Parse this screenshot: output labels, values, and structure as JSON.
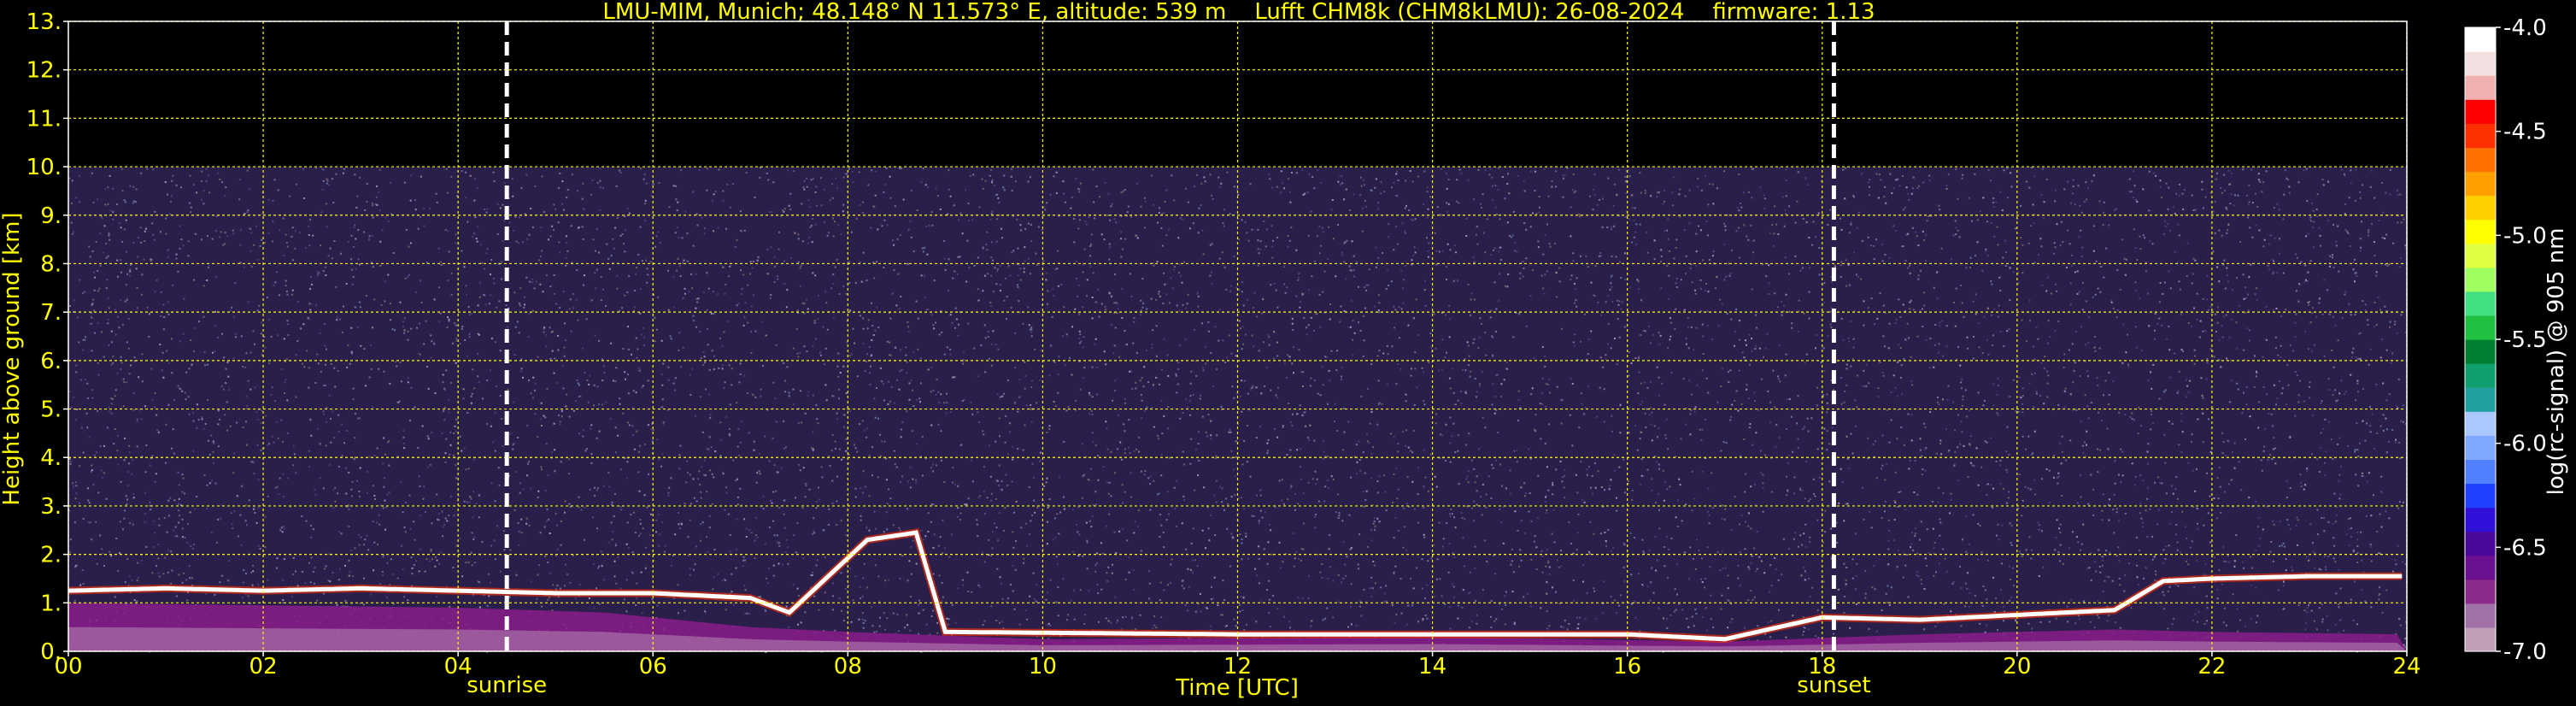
{
  "chart_data": {
    "type": "heatmap",
    "title": "LMU-MIM, Munich; 48.148° N 11.573° E, altitude: 539 m    Lufft CHM8k (CHM8kLMU): 26-08-2024    firmware: 1.13",
    "xlabel": "Time [UTC]",
    "ylabel": "Height above ground [km]",
    "x_ticks": [
      "00",
      "02",
      "04",
      "06",
      "08",
      "10",
      "12",
      "14",
      "16",
      "18",
      "20",
      "22",
      "24"
    ],
    "x_tick_values": [
      0,
      2,
      4,
      6,
      8,
      10,
      12,
      14,
      16,
      18,
      20,
      22,
      24
    ],
    "y_ticks": [
      "0.",
      "1.",
      "2.",
      "3.",
      "4.",
      "5.",
      "6.",
      "7.",
      "8.",
      "9.",
      "10.",
      "11.",
      "12.",
      "13."
    ],
    "y_tick_values": [
      0,
      1,
      2,
      3,
      4,
      5,
      6,
      7,
      8,
      9,
      10,
      11,
      12,
      13
    ],
    "xlim": [
      0,
      24
    ],
    "ylim": [
      0,
      13
    ],
    "grid": true,
    "grid_color": "#ffff00",
    "text_color": "#ffff00",
    "background": "#000000",
    "data_top_km": 10.0,
    "markers": [
      {
        "label": "sunrise",
        "time": 4.5
      },
      {
        "label": "sunset",
        "time": 18.12
      }
    ],
    "colorbar": {
      "label": "log(rc-signal) @ 905 nm",
      "range": [
        -7.0,
        -4.0
      ],
      "tick_labels": [
        "-4.0",
        "-4.5",
        "-5.0",
        "-5.5",
        "-6.0",
        "-6.5",
        "-7.0"
      ],
      "tick_values": [
        -4.0,
        -4.5,
        -5.0,
        -5.5,
        -6.0,
        -6.5,
        -7.0
      ],
      "colors": [
        "#c0a0b8",
        "#a070a8",
        "#8c2a8c",
        "#6a1090",
        "#4a0898",
        "#3010d8",
        "#2040ff",
        "#5080ff",
        "#80a8ff",
        "#a8c8ff",
        "#20a0a0",
        "#10a070",
        "#008030",
        "#20c040",
        "#40e080",
        "#a0ff60",
        "#e0ff40",
        "#ffff00",
        "#ffd000",
        "#ffa000",
        "#ff7000",
        "#ff3000",
        "#ff0000",
        "#f0b0b0",
        "#f0e0e0",
        "#ffffff"
      ]
    },
    "cloud_base_km": [
      [
        0.0,
        1.25
      ],
      [
        1.0,
        1.3
      ],
      [
        2.0,
        1.25
      ],
      [
        3.0,
        1.3
      ],
      [
        4.0,
        1.25
      ],
      [
        5.0,
        1.2
      ],
      [
        6.0,
        1.2
      ],
      [
        7.0,
        1.1
      ],
      [
        7.4,
        0.8
      ],
      [
        8.2,
        2.3
      ],
      [
        8.7,
        2.45
      ],
      [
        9.0,
        0.4
      ],
      [
        12.0,
        0.35
      ],
      [
        14.0,
        0.35
      ],
      [
        16.0,
        0.35
      ],
      [
        17.0,
        0.25
      ],
      [
        18.0,
        0.7
      ],
      [
        19.0,
        0.65
      ],
      [
        20.0,
        0.75
      ],
      [
        21.0,
        0.85
      ],
      [
        21.5,
        1.45
      ],
      [
        22.0,
        1.5
      ],
      [
        23.0,
        1.55
      ]
    ],
    "mixing_layer_km": [
      [
        0.0,
        1.0
      ],
      [
        2.0,
        0.95
      ],
      [
        4.0,
        0.9
      ],
      [
        5.5,
        0.8
      ],
      [
        7.0,
        0.5
      ],
      [
        8.0,
        0.4
      ],
      [
        10.0,
        0.25
      ],
      [
        14.0,
        0.3
      ],
      [
        17.0,
        0.2
      ],
      [
        19.0,
        0.35
      ],
      [
        21.0,
        0.45
      ],
      [
        22.0,
        0.4
      ],
      [
        24.0,
        0.35
      ]
    ]
  }
}
